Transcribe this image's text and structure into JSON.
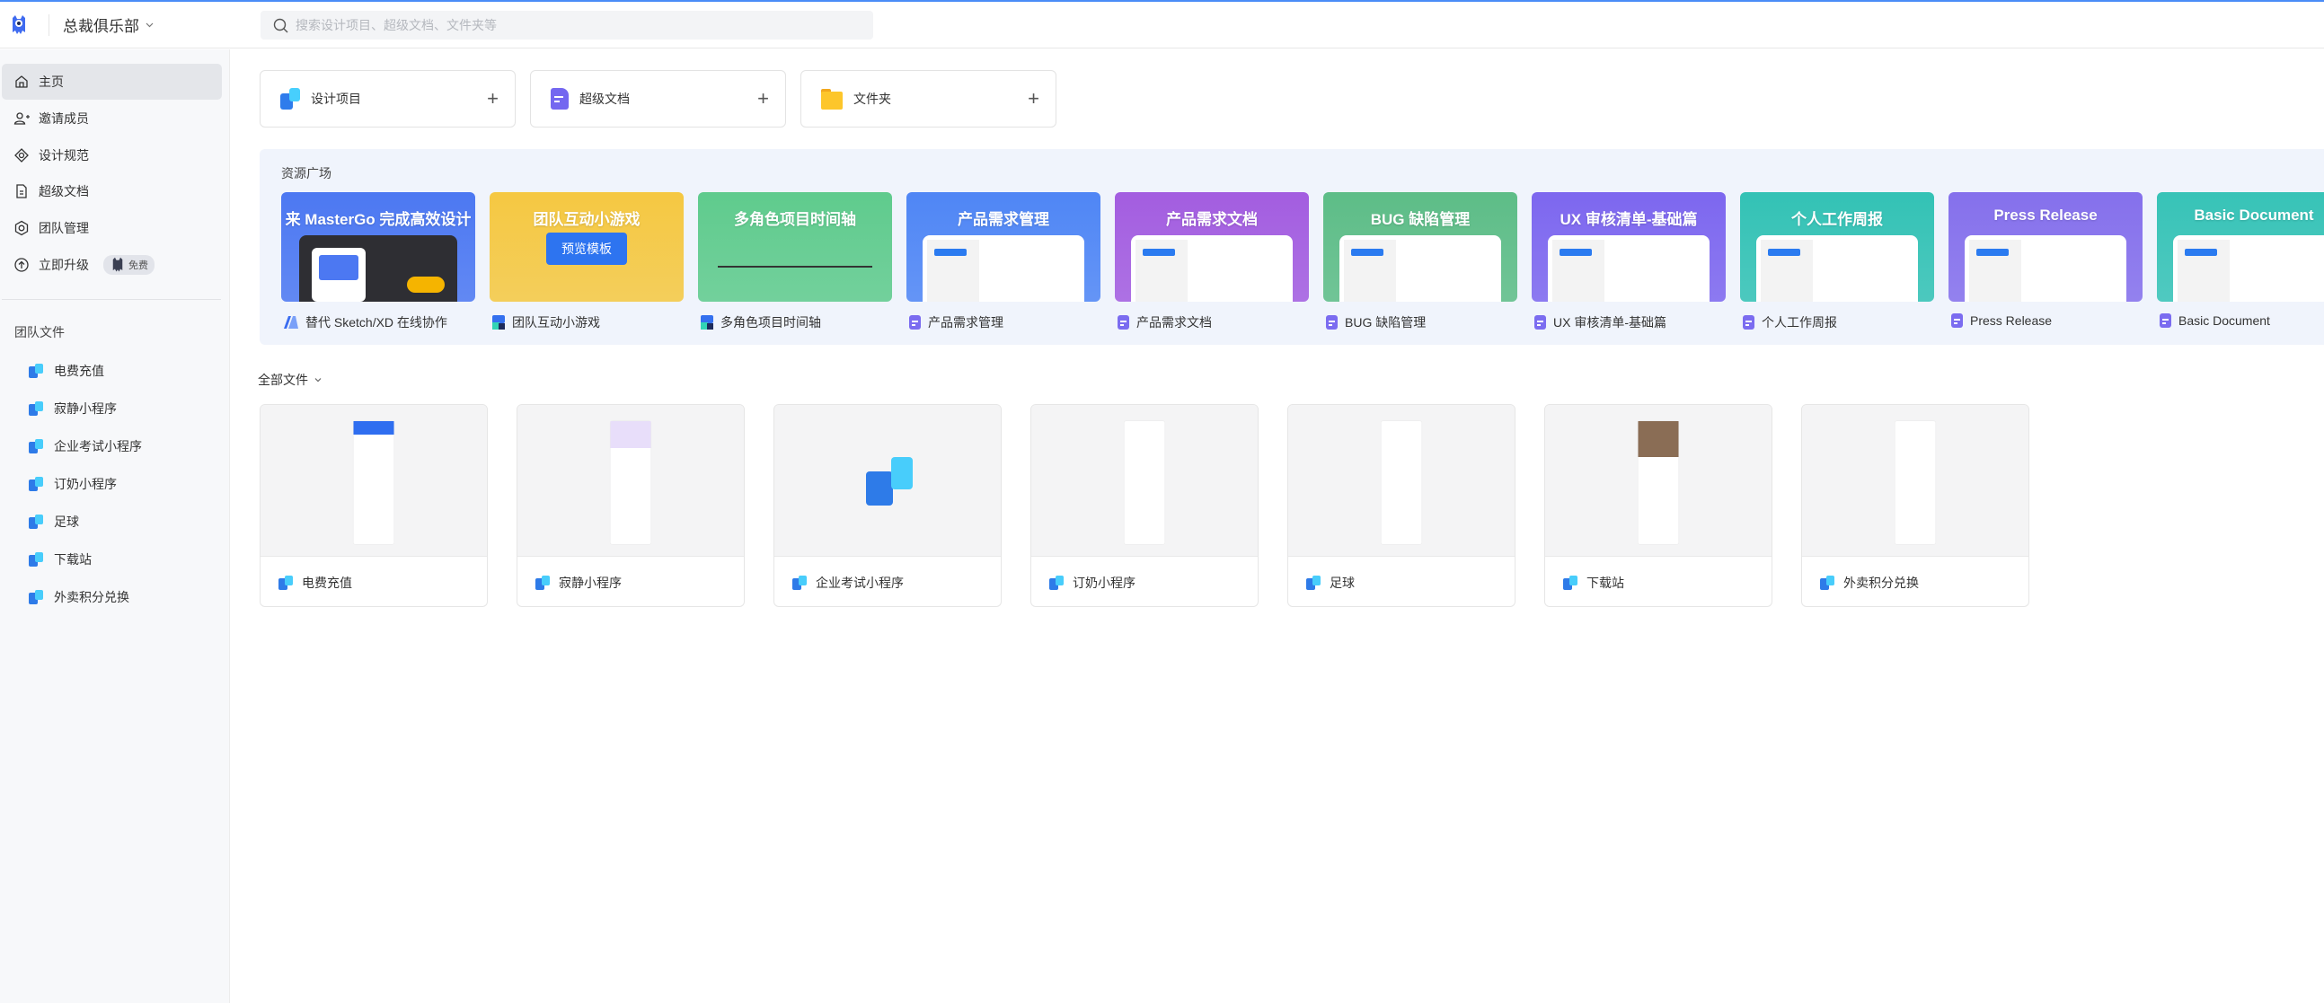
{
  "header": {
    "team_name": "总裁俱乐部",
    "search_placeholder": "搜索设计项目、超级文档、文件夹等"
  },
  "sidebar": {
    "items": [
      {
        "label": "主页",
        "icon": "home-icon",
        "active": true
      },
      {
        "label": "邀请成员",
        "icon": "user-plus-icon"
      },
      {
        "label": "设计规范",
        "icon": "diamond-icon"
      },
      {
        "label": "超级文档",
        "icon": "document-icon"
      },
      {
        "label": "团队管理",
        "icon": "settings-hex-icon"
      },
      {
        "label": "立即升级",
        "icon": "upgrade-icon",
        "badge": "免费"
      }
    ],
    "section_title": "团队文件",
    "files": [
      "电费充值",
      "寂静小程序",
      "企业考试小程序",
      "订奶小程序",
      "足球",
      "下载站",
      "外卖积分兑换"
    ]
  },
  "quick_create": [
    {
      "label": "设计项目",
      "icon": "design-project-icon"
    },
    {
      "label": "超级文档",
      "icon": "super-doc-icon"
    },
    {
      "label": "文件夹",
      "icon": "folder-icon"
    }
  ],
  "resources": {
    "title": "资源广场",
    "cards": [
      {
        "banner": "来 MasterGo 完成高效设计",
        "label": "替代 Sketch/XD 在线协作",
        "color": "#4c78f2",
        "icon": "mastergo-icon",
        "hover": "预览模板"
      },
      {
        "banner": "团队互动小游戏",
        "label": "团队互动小游戏",
        "color": "#f5c842",
        "icon": "whiteboard-icon",
        "hover": "预览模板"
      },
      {
        "banner": "多角色项目时间轴",
        "label": "多角色项目时间轴",
        "color": "#5fcb8d",
        "icon": "whiteboard-icon"
      },
      {
        "banner": "产品需求管理",
        "label": "产品需求管理",
        "color": "#4f86f5",
        "icon": "doc-icon"
      },
      {
        "banner": "产品需求文档",
        "label": "产品需求文档",
        "color": "#a35de0",
        "icon": "doc-icon"
      },
      {
        "banner": "BUG 缺陷管理",
        "label": "BUG 缺陷管理",
        "color": "#5dbd87",
        "icon": "doc-icon"
      },
      {
        "banner": "UX 审核清单-基础篇",
        "label": "UX 审核清单-基础篇",
        "color": "#7d67ef",
        "icon": "doc-icon"
      },
      {
        "banner": "个人工作周报",
        "label": "个人工作周报",
        "color": "#33c2b5",
        "icon": "doc-icon"
      },
      {
        "banner": "Press Release",
        "label": "Press Release",
        "color": "#8570ec",
        "icon": "doc-icon"
      },
      {
        "banner": "Basic Document",
        "label": "Basic Document",
        "color": "#37c3b7",
        "icon": "doc-icon"
      }
    ],
    "preview_button": "预览模板"
  },
  "all_files": {
    "title": "全部文件",
    "files": [
      "电费充值",
      "寂静小程序",
      "企业考试小程序",
      "订奶小程序",
      "足球",
      "下载站",
      "外卖积分兑换"
    ]
  }
}
